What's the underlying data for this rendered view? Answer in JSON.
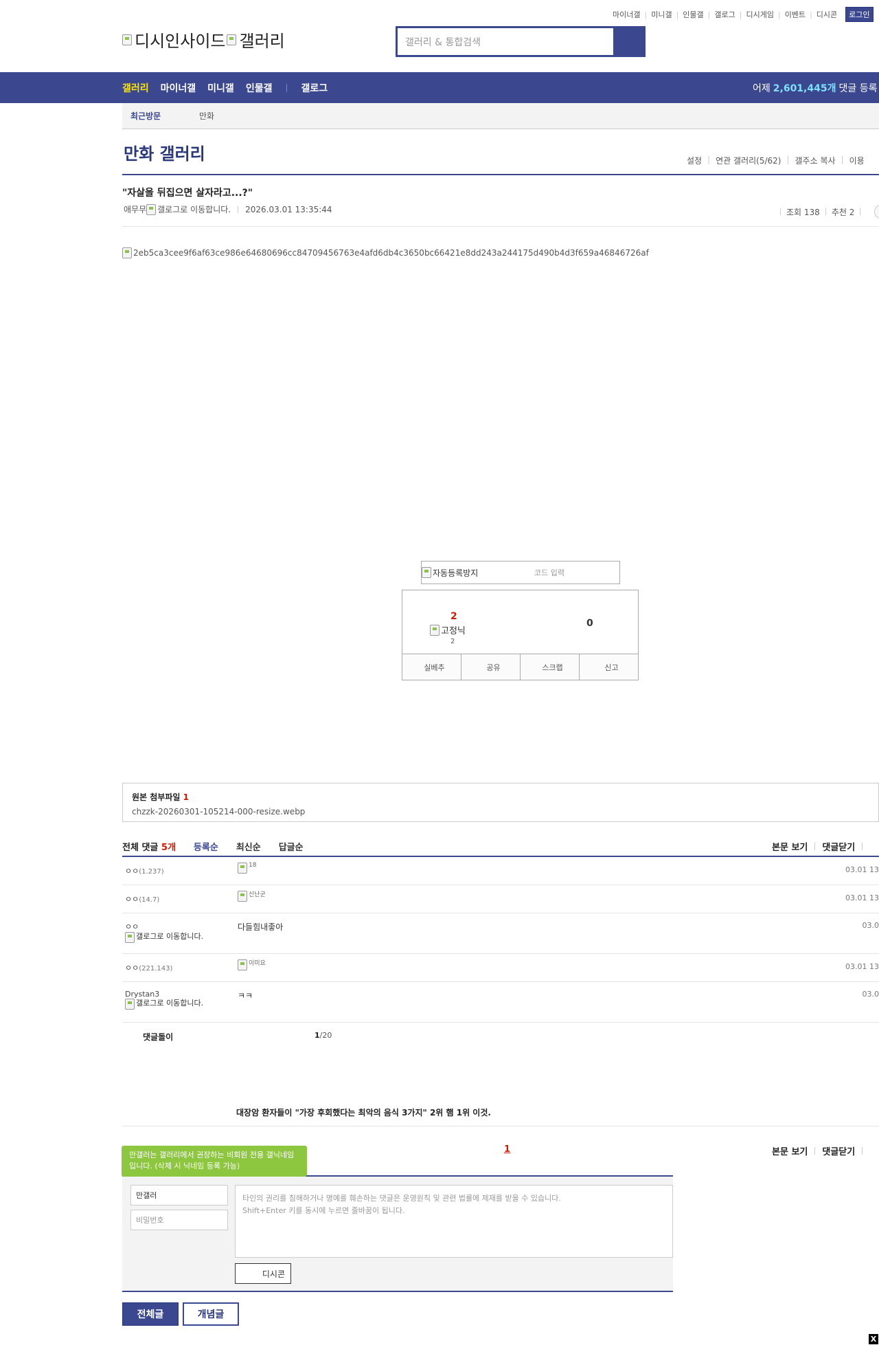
{
  "top_util": {
    "links": [
      "마이너갤",
      "미니갤",
      "인물갤",
      "갤로그",
      "디시게임",
      "이벤트",
      "디시콘"
    ],
    "login_label": "로그인"
  },
  "logo": {
    "part1": "디시인사이드",
    "part2": "갤러리"
  },
  "search": {
    "placeholder": "갤러리 & 통합검색"
  },
  "gnb": {
    "items": [
      "갤러리",
      "마이너갤",
      "미니갤",
      "인물갤",
      "갤로그"
    ],
    "count_prefix": "어제",
    "count_value": "2,601,445개",
    "count_suffix": "댓글 등록"
  },
  "recent": {
    "label": "최근방문",
    "item": "만화"
  },
  "gallery": {
    "title": "만화 갤러리",
    "menu": [
      "설정",
      "연관 갤러리(5/62)",
      "갤주소 복사",
      "이용"
    ]
  },
  "post": {
    "title": "\"자살을 뒤집으면 살자라고...?\"",
    "author": "애무무",
    "gallog_alt": "갤로그로 이동합니다.",
    "date": "2026.03.01 13:35:44",
    "views": "조회 138",
    "recommend": "추천 2",
    "image_alt": "2eb5ca3cee9f6af63ce986e64680696cc84709456763e4afd6db4c3650bc66421e8dd243a244175d490b4d3f659a46846726af"
  },
  "captcha": {
    "alt": "자동등록방지",
    "placeholder": "코드 입력"
  },
  "recommend_box": {
    "up": "2",
    "fixed_alt": "고정닉",
    "fixed_count": "2",
    "down": "0",
    "buttons": [
      "실베추",
      "공유",
      "스크랩",
      "신고"
    ]
  },
  "attachment": {
    "label": "원본 첨부파일",
    "count": "1",
    "filename": "chzzk-20260301-105214-000-resize.webp"
  },
  "comments": {
    "label": "전체 댓글",
    "count": "5개",
    "tabs": [
      "등록순",
      "최신순",
      "답글순"
    ],
    "right": [
      "본문 보기",
      "댓글닫기"
    ],
    "rows": [
      {
        "nick": "ㅇㅇ",
        "ip": "(1.237)",
        "text": "18",
        "text_is_image": true,
        "date": "03.01 13"
      },
      {
        "nick": "ㅇㅇ",
        "ip": "(14.7)",
        "text": "신난군",
        "text_is_image": true,
        "date": "03.01 13"
      },
      {
        "nick": "ㅇㅇ",
        "gallog": "갤로그로 이동합니다.",
        "text": "다들힘내좋아",
        "text_is_image": false,
        "date": "03.0"
      },
      {
        "nick": "ㅇㅇ",
        "ip": "(221.143)",
        "text": "이미요",
        "text_is_image": true,
        "date": "03.01 13"
      },
      {
        "nick": "Drystan3",
        "gallog": "갤로그로 이동합니다.",
        "text": "ㅋㅋ",
        "text_is_image": false,
        "date": "03.0"
      }
    ],
    "footer_label": "댓글돌이",
    "page_current": "1",
    "page_total": "/20"
  },
  "ad_title": "대장암 환자들이 \"가장 후회했다는 최악의 음식 3가지\" 2위 햄 1위 이것.",
  "write": {
    "page_num": "1",
    "tip": "만갤러는 갤러리에서 권장하는 비회원 전용 갤닉네임입니다. (삭제 시 닉네임 등록 가능)",
    "nick_value": "만갤러",
    "pw_placeholder": "비밀번호",
    "textarea_line1": "타인의 권리를 침해하거나 명예를 훼손하는 댓글은 운영원칙 및 관련 법률에 제재를 받을 수 있습니다.",
    "textarea_line2": "Shift+Enter 키를 동시에 누르면 줄바꿈이 됩니다.",
    "dccon_label": "디시콘"
  },
  "bottom_buttons": {
    "all": "전체글",
    "best": "개념글"
  },
  "close_label": "X"
}
